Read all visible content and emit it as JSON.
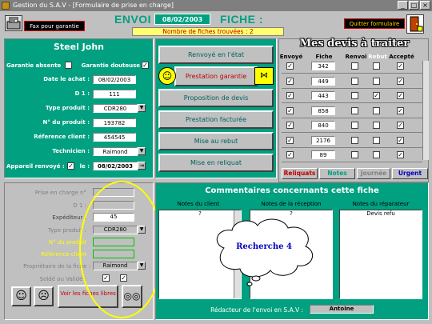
{
  "window": {
    "title": "Gestion du S.A.V - [Formulaire de prise en charge]",
    "minimize": "_",
    "maximize": "□",
    "close": "×"
  },
  "header": {
    "fax_label": "Fax pour garantie",
    "envoi_label": "ENVOI :",
    "envoi_date": "08/02/2003",
    "fiche_label": "FICHE :",
    "nb_fiches": "Nombre de fiches trouvées : 2",
    "quit_label": "Quitter formulaire"
  },
  "client": {
    "name": "Steel    John",
    "garantie_absente": "Garantie absente",
    "garantie_absente_checked": "",
    "garantie_douteuse": "Garantie douteuse",
    "garantie_douteuse_checked": "✓",
    "date_achat_label": "Date le achat :",
    "date_achat": "08/02/2003",
    "d1_label": "D 1 :",
    "d1": "111",
    "type_produit_label": "Type produit :",
    "type_produit": "CDR280",
    "no_produit_label": "N° du produit :",
    "no_produit": "193782",
    "ref_client_label": "Réference client :",
    "ref_client": "454545",
    "technicien_label": "Technicien :",
    "technicien": "Raimond",
    "appareil_label": "Appareil renvoyé :",
    "appareil_checked": "✓",
    "le_label": "le :",
    "le_date": "08/02/2003"
  },
  "actions": {
    "renvoye": "Renvoyé en l'état",
    "prestation_garantie": "Prestation garantie",
    "proposition": "Proposition de devis",
    "facturee": "Prestation facturée",
    "rebut": "Mise au  rebut",
    "reliquat": "Mise en reliquat"
  },
  "devis": {
    "title": "Mes devis à traiter",
    "headers": [
      "Envoyé",
      "Fiche",
      "Renvoi",
      "Rebut",
      "Accepté"
    ],
    "rows": [
      {
        "envoye": "✓",
        "fiche": "342",
        "renvoi": "",
        "rebut": "",
        "accepte": "✓"
      },
      {
        "envoye": "✓",
        "fiche": "449",
        "renvoi": "",
        "rebut": "",
        "accepte": "✓"
      },
      {
        "envoye": "✓",
        "fiche": "443",
        "renvoi": "",
        "rebut": "✓",
        "accepte": "✓"
      },
      {
        "envoye": "✓",
        "fiche": "858",
        "renvoi": "",
        "rebut": "",
        "accepte": "✓"
      },
      {
        "envoye": "✓",
        "fiche": "840",
        "renvoi": "",
        "rebut": "",
        "accepte": "✓"
      },
      {
        "envoye": "✓",
        "fiche": "2176",
        "renvoi": "",
        "rebut": "",
        "accepte": "✓"
      },
      {
        "envoye": "✓",
        "fiche": "89",
        "renvoi": "",
        "rebut": "",
        "accepte": "✓"
      }
    ],
    "tabs": [
      "Reliquats",
      "Notes",
      "Journée",
      "Urgent"
    ]
  },
  "lower": {
    "prise_label": "Prise en charge n°",
    "d1_label": "D 1 :",
    "expediteur_label": "Expéditeur :",
    "expediteur": "45",
    "type_label": "Type produit :",
    "type": "CDR280",
    "no_label": "N° du produit",
    "ref_label": "Référence client",
    "proprio_label": "Propriétaire de la fiche :",
    "proprio": "Raimond",
    "solde_label": "Soldé ou Validé :",
    "solde_checked": "✓",
    "valide_checked": "✓",
    "voir_label": "Voir les fiches libres"
  },
  "comments": {
    "title": "Commentaires concernants cette fiche",
    "client_hdr": "Notes du client",
    "reception_hdr": "Notes de la réception",
    "reparateur_hdr": "Notes du réparateur",
    "client_text": "?",
    "reception_text": "?",
    "reparateur_text": "Devis refu",
    "redacteur_label": "Rédacteur de l'envoi en S.A.V :",
    "redacteur": "Antoine",
    "cloud_text": "Recherche 4"
  },
  "colors": {
    "green": "#00a080",
    "red": "#c00000",
    "yellow": "#ffff70",
    "blue": "#0000c0"
  }
}
